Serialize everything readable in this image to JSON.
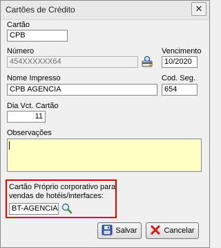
{
  "window": {
    "title": "Cartões de Crédito",
    "close_glyph": "✕"
  },
  "form": {
    "cartao": {
      "label": "Cartão",
      "value": "CPB"
    },
    "numero": {
      "label": "Número",
      "value": "454XXXXXX64"
    },
    "vencimento": {
      "label": "Vencimento",
      "value": "10/2020"
    },
    "nome_impresso": {
      "label": "Nome Impresso",
      "value": "CPB AGENCIA"
    },
    "cod_seg": {
      "label": "Cod. Seg.",
      "value": "654"
    },
    "dia_vct": {
      "label": "Dia Vct. Cartão",
      "value": "11"
    },
    "observacoes": {
      "label": "Observações",
      "value": ""
    }
  },
  "corporate": {
    "label_line1": "Cartão Próprio corporativo para",
    "label_line2": "vendas de hotéis/interfaces:",
    "value": "BT-AGENCIA"
  },
  "buttons": {
    "save_label": "Salvar",
    "cancel_label": "Cancelar"
  },
  "icons": {
    "card_lookup": "card-lookup-icon",
    "search": "search-icon",
    "save": "floppy-disk-icon",
    "cancel": "cancel-x-icon"
  },
  "colors": {
    "highlight_border": "#e00000",
    "memo_bg": "#ffffc6"
  }
}
